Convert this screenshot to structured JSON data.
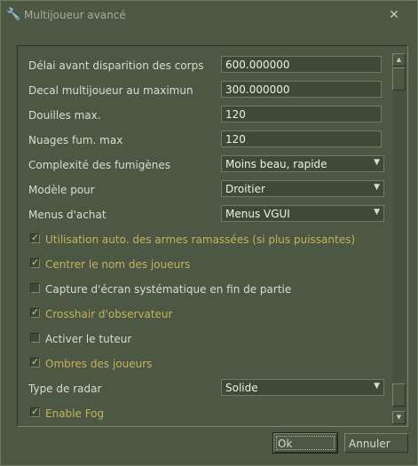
{
  "window": {
    "title": "Multijoueur avancé",
    "close_symbol": "✕",
    "title_icon_glyph": "🔧"
  },
  "settings": {
    "decal_body": {
      "label": "Délai avant disparition des corps",
      "value": "600.000000"
    },
    "decal_max": {
      "label": "Decal multijoueur au maximun",
      "value": "300.000000"
    },
    "shells_max": {
      "label": "Douilles max.",
      "value": "120"
    },
    "smoke_max": {
      "label": "Nuages fum. max",
      "value": "120"
    },
    "smoke_complexity": {
      "label": "Complexité des fumigènes",
      "value": "Moins beau, rapide"
    },
    "model": {
      "label": "Modèle pour",
      "value": "Droitier"
    },
    "buy_menu": {
      "label": "Menus d'achat",
      "value": "Menus VGUI"
    },
    "auto_weapons": {
      "label": "Utilisation auto. des armes ramassées (si plus puissantes)",
      "checked": true
    },
    "center_names": {
      "label": "Centrer le nom des joueurs",
      "checked": true
    },
    "screenshot": {
      "label": "Capture d'écran systématique en fin de partie",
      "checked": false
    },
    "crosshair": {
      "label": "Crosshair d'observateur",
      "checked": true
    },
    "tutor": {
      "label": "Activer le tuteur",
      "checked": false
    },
    "shadows": {
      "label": "Ombres des joueurs",
      "checked": true
    },
    "radar": {
      "label": "Type de radar",
      "value": "Solide"
    },
    "fog": {
      "label": "Enable Fog",
      "checked": true
    }
  },
  "symbols": {
    "check": "✓",
    "dropdown_arrow": "▼",
    "scroll_up": "▲",
    "scroll_down": "▼"
  },
  "buttons": {
    "ok": "Ok",
    "cancel": "Annuler"
  },
  "colors": {
    "background": "#4c5844",
    "enabled_text": "#c5b35a",
    "text": "#d8dccf"
  }
}
